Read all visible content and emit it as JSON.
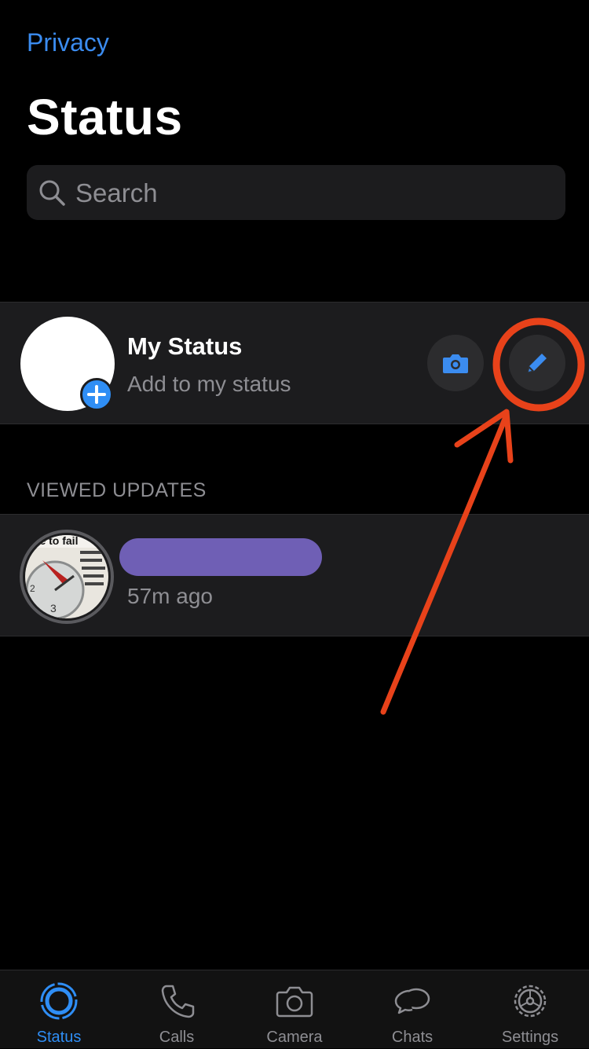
{
  "header": {
    "privacy_link": "Privacy",
    "title": "Status"
  },
  "search": {
    "placeholder": "Search",
    "icon": "search-icon"
  },
  "my_status": {
    "name": "My Status",
    "subtitle": "Add to my status",
    "add_icon": "plus-icon",
    "camera_icon": "camera-icon",
    "pencil_icon": "pencil-icon"
  },
  "viewed_updates": {
    "section_title": "VIEWED UPDATES",
    "items": [
      {
        "time": "57m ago"
      }
    ]
  },
  "tab_bar": {
    "tabs": [
      {
        "label": "Status",
        "icon": "status-icon",
        "active": true
      },
      {
        "label": "Calls",
        "icon": "phone-icon",
        "active": false
      },
      {
        "label": "Camera",
        "icon": "camera-icon",
        "active": false
      },
      {
        "label": "Chats",
        "icon": "chat-bubbles-icon",
        "active": false
      },
      {
        "label": "Settings",
        "icon": "gear-icon",
        "active": false
      }
    ]
  },
  "colors": {
    "accent": "#2f8ef5",
    "link": "#3b8cf0",
    "row_background": "#1c1c1e",
    "secondary_text": "#8e8e93",
    "annotation": "#e8421a",
    "redaction": "#6f5fb5"
  }
}
